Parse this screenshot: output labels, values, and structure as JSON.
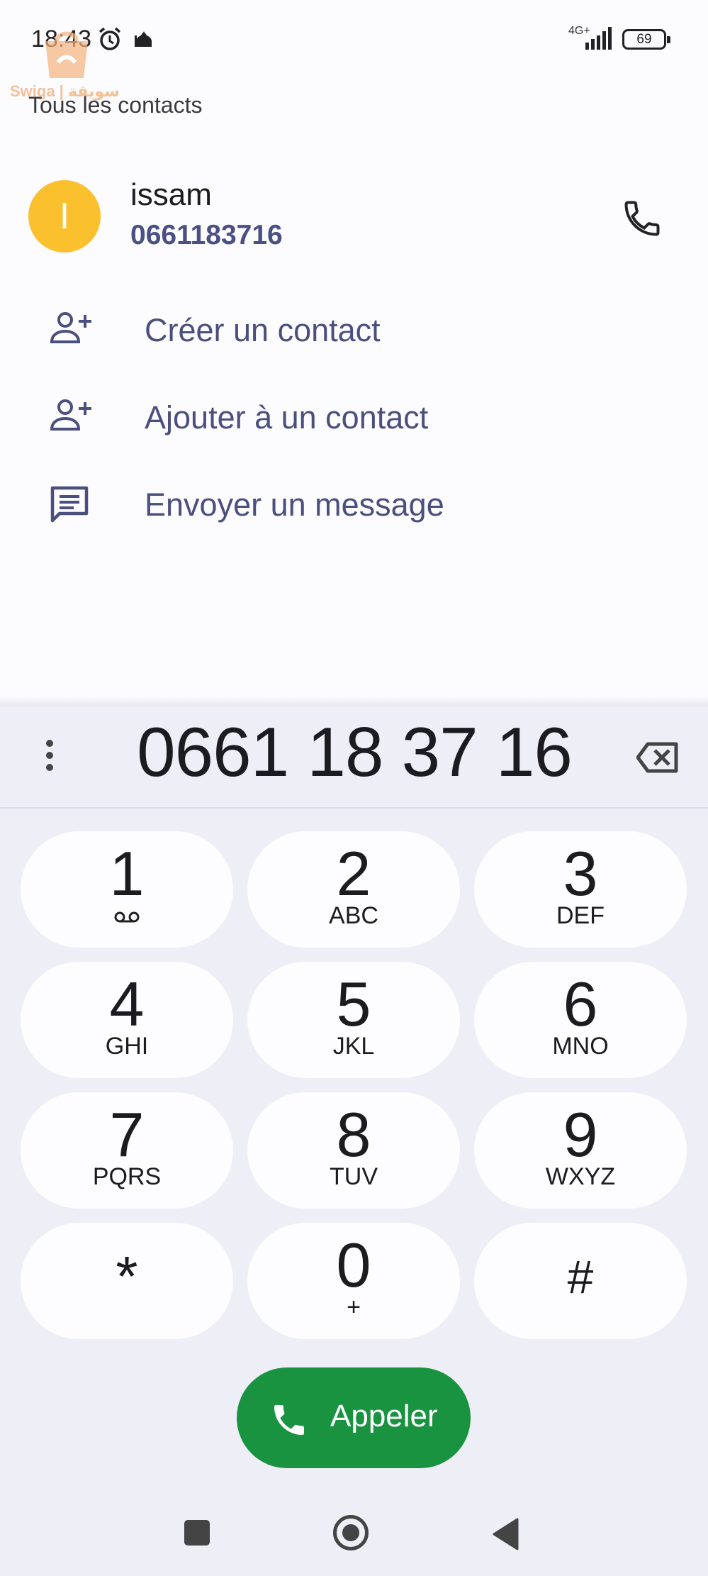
{
  "status_bar": {
    "time": "18:43",
    "network": "4G+",
    "battery": "69"
  },
  "watermark": {
    "text": "Swiga | سويقة"
  },
  "contacts": {
    "section_title": "Tous les contacts",
    "contact": {
      "initial": "I",
      "avatar_color": "#fbc02d",
      "name": "issam",
      "number": "0661183716"
    },
    "actions": [
      {
        "label": "Créer un contact",
        "icon": "add-person-icon"
      },
      {
        "label": "Ajouter à un contact",
        "icon": "add-person-icon"
      },
      {
        "label": "Envoyer un message",
        "icon": "message-icon"
      }
    ]
  },
  "dialer": {
    "number": "0661 18 37 16",
    "keys": [
      {
        "digit": "1",
        "letters": ""
      },
      {
        "digit": "2",
        "letters": "ABC"
      },
      {
        "digit": "3",
        "letters": "DEF"
      },
      {
        "digit": "4",
        "letters": "GHI"
      },
      {
        "digit": "5",
        "letters": "JKL"
      },
      {
        "digit": "6",
        "letters": "MNO"
      },
      {
        "digit": "7",
        "letters": "PQRS"
      },
      {
        "digit": "8",
        "letters": "TUV"
      },
      {
        "digit": "9",
        "letters": "WXYZ"
      },
      {
        "digit": "*",
        "letters": ""
      },
      {
        "digit": "0",
        "letters": "+"
      },
      {
        "digit": "#",
        "letters": ""
      }
    ],
    "call_label": "Appeler",
    "call_color": "#1a9340"
  }
}
